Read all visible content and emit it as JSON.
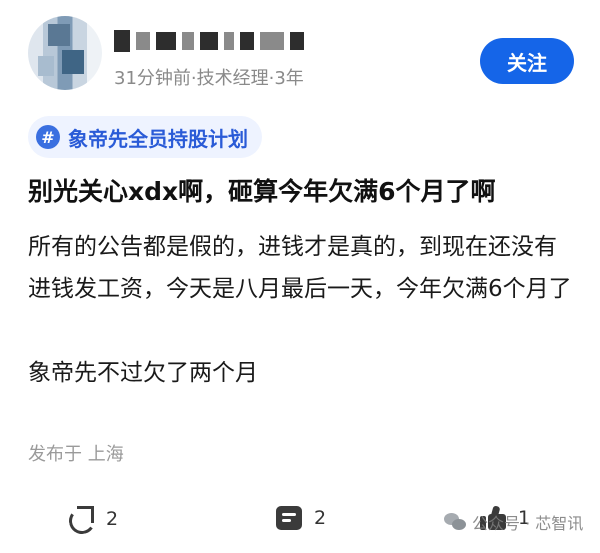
{
  "user": {
    "meta": "31分钟前·技术经理·3年"
  },
  "follow_label": "关注",
  "topic": {
    "icon": "#",
    "label": "象帝先全员持股计划"
  },
  "post": {
    "title": "别光关心xdx啊，砸算今年欠满6个月了啊",
    "paragraphs": [
      "所有的公告都是假的，进钱才是真的，到现在还没有进钱发工资，今天是八月最后一天，今年欠满6个月了",
      "象帝先不过欠了两个月"
    ]
  },
  "location": "发布于 上海",
  "actions": {
    "share_count": "2",
    "comment_count": "2",
    "like_count": "1"
  },
  "watermark": "公众号 · 芯智讯",
  "colors": {
    "accent": "#1565e8",
    "topic_bg": "#eef3ff",
    "topic_text": "#2a5bd7"
  }
}
